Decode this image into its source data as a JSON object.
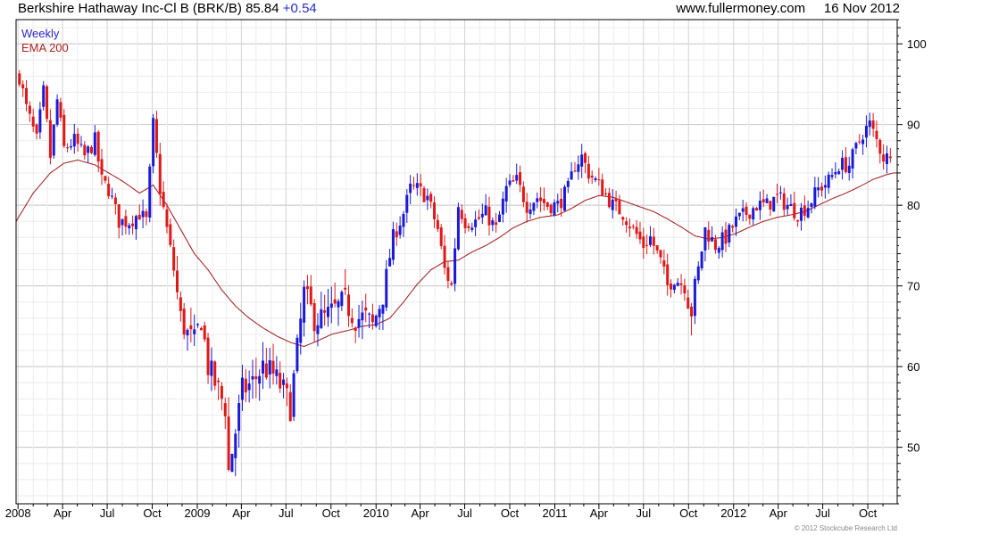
{
  "header": {
    "title": "Berkshire Hathaway Inc-Cl B (BRK/B)",
    "price": "85.84",
    "change": "+0.54",
    "source": "www.fullermoney.com",
    "date": "16 Nov 2012"
  },
  "footer": {
    "copyright": "© 2012 Stockcube Research Ltd"
  },
  "colors": {
    "up": "#1a1ad8",
    "down": "#e01818",
    "ema": "#a52a2a",
    "grid": "#d8d8d8",
    "axis": "#000000"
  },
  "chart_data": {
    "type": "candlestick",
    "series": [
      {
        "name": "Weekly"
      },
      {
        "name": "EMA 200"
      }
    ],
    "ylim": [
      43,
      103
    ],
    "y_ticks": [
      50,
      60,
      70,
      80,
      90,
      100
    ],
    "x_range": [
      "2007-12-28",
      "2012-11-30"
    ],
    "x_ticks": [
      {
        "date": "2008-01-01",
        "label": "2008"
      },
      {
        "date": "2008-04-01",
        "label": "Apr"
      },
      {
        "date": "2008-07-01",
        "label": "Jul"
      },
      {
        "date": "2008-10-01",
        "label": "Oct"
      },
      {
        "date": "2009-01-01",
        "label": "2009"
      },
      {
        "date": "2009-04-01",
        "label": "Apr"
      },
      {
        "date": "2009-07-01",
        "label": "Jul"
      },
      {
        "date": "2009-10-01",
        "label": "Oct"
      },
      {
        "date": "2010-01-01",
        "label": "2010"
      },
      {
        "date": "2010-04-01",
        "label": "Apr"
      },
      {
        "date": "2010-07-01",
        "label": "Jul"
      },
      {
        "date": "2010-10-01",
        "label": "Oct"
      },
      {
        "date": "2011-01-01",
        "label": "2011"
      },
      {
        "date": "2011-04-01",
        "label": "Apr"
      },
      {
        "date": "2011-07-01",
        "label": "Jul"
      },
      {
        "date": "2011-10-01",
        "label": "Oct"
      },
      {
        "date": "2012-01-01",
        "label": "2012"
      },
      {
        "date": "2012-04-01",
        "label": "Apr"
      },
      {
        "date": "2012-07-01",
        "label": "Jul"
      },
      {
        "date": "2012-10-01",
        "label": "Oct"
      }
    ],
    "close_anchors": [
      [
        "2008-01-04",
        96
      ],
      [
        "2008-01-18",
        92
      ],
      [
        "2008-02-08",
        88
      ],
      [
        "2008-02-22",
        94
      ],
      [
        "2008-03-07",
        86
      ],
      [
        "2008-03-21",
        93
      ],
      [
        "2008-04-04",
        87
      ],
      [
        "2008-04-25",
        88
      ],
      [
        "2008-05-16",
        86
      ],
      [
        "2008-06-06",
        88
      ],
      [
        "2008-06-20",
        83
      ],
      [
        "2008-07-04",
        82
      ],
      [
        "2008-07-25",
        78
      ],
      [
        "2008-08-15",
        78
      ],
      [
        "2008-09-05",
        79
      ],
      [
        "2008-09-19",
        78
      ],
      [
        "2008-10-03",
        90
      ],
      [
        "2008-10-17",
        82
      ],
      [
        "2008-10-31",
        77
      ],
      [
        "2008-11-14",
        72
      ],
      [
        "2008-11-28",
        66
      ],
      [
        "2008-12-12",
        64
      ],
      [
        "2008-12-26",
        63
      ],
      [
        "2009-01-09",
        66
      ],
      [
        "2009-01-23",
        60
      ],
      [
        "2009-02-13",
        57
      ],
      [
        "2009-02-27",
        55
      ],
      [
        "2009-03-06",
        47
      ],
      [
        "2009-03-20",
        52
      ],
      [
        "2009-04-03",
        57
      ],
      [
        "2009-04-24",
        58
      ],
      [
        "2009-05-15",
        60
      ],
      [
        "2009-06-05",
        59
      ],
      [
        "2009-06-26",
        57
      ],
      [
        "2009-07-10",
        55
      ],
      [
        "2009-07-24",
        62
      ],
      [
        "2009-08-07",
        69
      ],
      [
        "2009-08-28",
        66
      ],
      [
        "2009-09-18",
        66
      ],
      [
        "2009-10-09",
        67
      ],
      [
        "2009-10-30",
        68
      ],
      [
        "2009-11-20",
        66
      ],
      [
        "2009-12-11",
        66
      ],
      [
        "2009-12-25",
        65
      ],
      [
        "2010-01-15",
        69
      ],
      [
        "2010-02-05",
        76
      ],
      [
        "2010-02-26",
        79
      ],
      [
        "2010-03-12",
        82
      ],
      [
        "2010-03-26",
        82
      ],
      [
        "2010-04-16",
        81
      ],
      [
        "2010-05-07",
        77
      ],
      [
        "2010-05-21",
        72
      ],
      [
        "2010-06-04",
        70
      ],
      [
        "2010-06-18",
        80
      ],
      [
        "2010-07-02",
        78
      ],
      [
        "2010-07-23",
        78
      ],
      [
        "2010-08-13",
        79
      ],
      [
        "2010-09-03",
        77
      ],
      [
        "2010-09-24",
        82
      ],
      [
        "2010-10-15",
        83
      ],
      [
        "2010-11-05",
        80
      ],
      [
        "2010-11-26",
        81
      ],
      [
        "2010-12-17",
        80
      ],
      [
        "2011-01-07",
        80
      ],
      [
        "2011-01-28",
        82
      ],
      [
        "2011-02-11",
        85
      ],
      [
        "2011-02-25",
        86
      ],
      [
        "2011-03-11",
        84
      ],
      [
        "2011-03-25",
        83
      ],
      [
        "2011-04-08",
        82
      ],
      [
        "2011-04-29",
        80
      ],
      [
        "2011-05-20",
        79
      ],
      [
        "2011-06-10",
        77
      ],
      [
        "2011-07-01",
        75
      ],
      [
        "2011-07-15",
        76
      ],
      [
        "2011-08-05",
        73
      ],
      [
        "2011-08-19",
        70
      ],
      [
        "2011-09-02",
        71
      ],
      [
        "2011-09-23",
        70
      ],
      [
        "2011-10-07",
        67
      ],
      [
        "2011-10-21",
        72
      ],
      [
        "2011-11-04",
        77
      ],
      [
        "2011-11-25",
        75
      ],
      [
        "2011-12-16",
        76
      ],
      [
        "2012-01-06",
        78
      ],
      [
        "2012-01-27",
        79
      ],
      [
        "2012-02-17",
        80
      ],
      [
        "2012-03-09",
        80
      ],
      [
        "2012-03-30",
        81
      ],
      [
        "2012-04-20",
        80
      ],
      [
        "2012-05-11",
        79
      ],
      [
        "2012-06-01",
        80
      ],
      [
        "2012-06-22",
        82
      ],
      [
        "2012-07-13",
        83
      ],
      [
        "2012-08-03",
        85
      ],
      [
        "2012-08-24",
        85
      ],
      [
        "2012-09-07",
        87
      ],
      [
        "2012-09-21",
        89
      ],
      [
        "2012-10-05",
        90
      ],
      [
        "2012-10-19",
        88
      ],
      [
        "2012-11-02",
        86
      ],
      [
        "2012-11-16",
        85.84
      ]
    ],
    "ema_anchors": [
      [
        "2007-12-28",
        78
      ],
      [
        "2008-02-01",
        81.5
      ],
      [
        "2008-03-07",
        84
      ],
      [
        "2008-04-04",
        85.2
      ],
      [
        "2008-05-02",
        85.6
      ],
      [
        "2008-06-06",
        85
      ],
      [
        "2008-07-04",
        84
      ],
      [
        "2008-08-01",
        83
      ],
      [
        "2008-09-05",
        81.5
      ],
      [
        "2008-10-03",
        82.5
      ],
      [
        "2008-10-31",
        80
      ],
      [
        "2008-11-28",
        77
      ],
      [
        "2008-12-26",
        74
      ],
      [
        "2009-01-23",
        72
      ],
      [
        "2009-02-20",
        69.5
      ],
      [
        "2009-03-20",
        67.5
      ],
      [
        "2009-04-17",
        66
      ],
      [
        "2009-05-15",
        64.8
      ],
      [
        "2009-06-12",
        63.8
      ],
      [
        "2009-07-10",
        63
      ],
      [
        "2009-08-07",
        62.5
      ],
      [
        "2009-09-04",
        63.2
      ],
      [
        "2009-10-02",
        64
      ],
      [
        "2009-11-06",
        64.5
      ],
      [
        "2009-12-04",
        65
      ],
      [
        "2010-01-01",
        65.2
      ],
      [
        "2010-01-29",
        66
      ],
      [
        "2010-02-26",
        68
      ],
      [
        "2010-03-26",
        70.2
      ],
      [
        "2010-04-23",
        72
      ],
      [
        "2010-05-21",
        73
      ],
      [
        "2010-06-18",
        73.2
      ],
      [
        "2010-07-16",
        74.2
      ],
      [
        "2010-08-13",
        75
      ],
      [
        "2010-09-10",
        76
      ],
      [
        "2010-10-08",
        77.2
      ],
      [
        "2010-11-05",
        78
      ],
      [
        "2010-12-03",
        78.5
      ],
      [
        "2011-01-07",
        78.8
      ],
      [
        "2011-02-04",
        79.6
      ],
      [
        "2011-03-04",
        80.6
      ],
      [
        "2011-04-01",
        81.2
      ],
      [
        "2011-04-29",
        81
      ],
      [
        "2011-05-27",
        80.4
      ],
      [
        "2011-06-24",
        79.8
      ],
      [
        "2011-07-22",
        79.2
      ],
      [
        "2011-08-19",
        78.3
      ],
      [
        "2011-09-16",
        77.3
      ],
      [
        "2011-10-14",
        76.2
      ],
      [
        "2011-11-11",
        75.8
      ],
      [
        "2011-12-09",
        76
      ],
      [
        "2012-01-06",
        76.5
      ],
      [
        "2012-02-03",
        77.3
      ],
      [
        "2012-03-02",
        78
      ],
      [
        "2012-03-30",
        78.5
      ],
      [
        "2012-04-27",
        78.8
      ],
      [
        "2012-05-25",
        79.2
      ],
      [
        "2012-06-22",
        80
      ],
      [
        "2012-07-20",
        80.8
      ],
      [
        "2012-08-17",
        81.5
      ],
      [
        "2012-09-14",
        82.3
      ],
      [
        "2012-10-12",
        83.2
      ],
      [
        "2012-11-09",
        83.8
      ],
      [
        "2012-11-23",
        84
      ]
    ]
  }
}
